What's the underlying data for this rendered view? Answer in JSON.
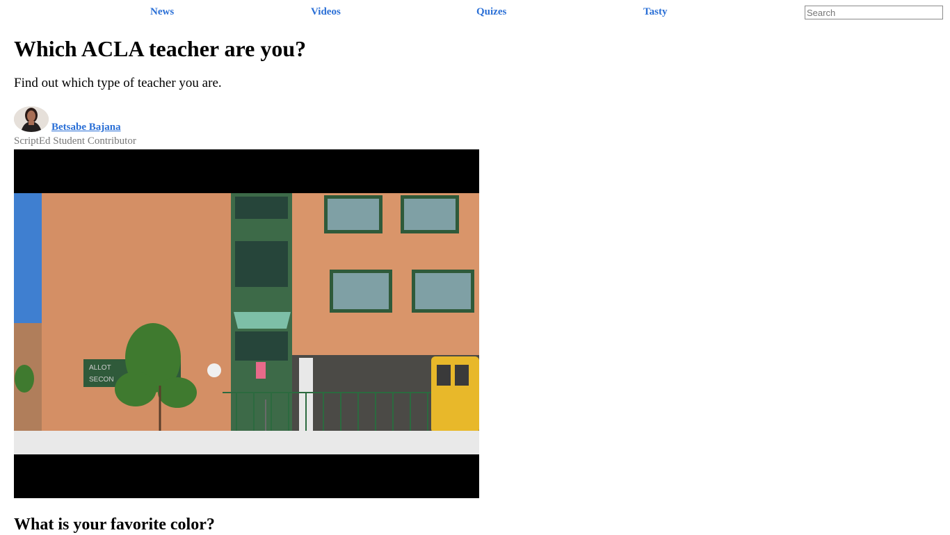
{
  "nav": {
    "links": [
      "News",
      "Videos",
      "Quizes",
      "Tasty"
    ],
    "search_placeholder": "Search"
  },
  "article": {
    "title": "Which ACLA teacher are you?",
    "subtitle": "Find out which type of teacher you are."
  },
  "author": {
    "name": "Betsabe Bajana",
    "role": "ScriptEd Student Contributor"
  },
  "video": {
    "sign_text_line1": "ALLOT",
    "sign_text_line2": "SECON"
  },
  "question": {
    "text": "What is your favorite color?"
  },
  "colors": {
    "link": "#2a6fd6",
    "muted_text": "#777777",
    "brick": "#d9956a",
    "window_frame": "#2f5a3a",
    "sky": "#3f7fd0",
    "bus": "#e8b82a"
  }
}
